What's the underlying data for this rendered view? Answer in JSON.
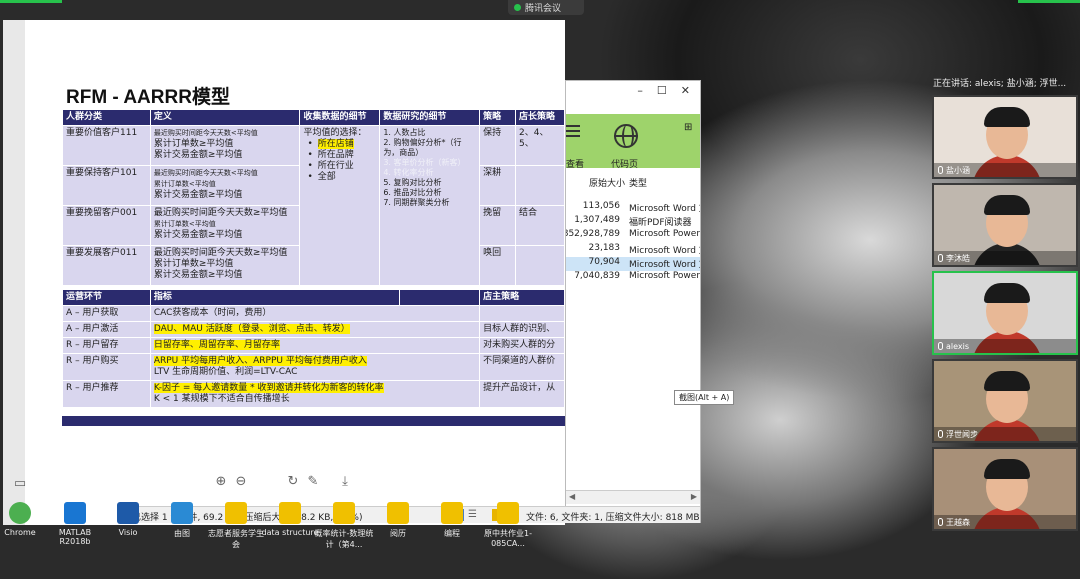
{
  "meeting": {
    "tab_label": "腾讯会议"
  },
  "slide": {
    "title": "RFM - AARRR模型",
    "rfm_headers": [
      "人群分类",
      "定义",
      "收集数据的细节",
      "数据研究的细节",
      "策略",
      "店长策略"
    ],
    "rfm_rows": [
      {
        "segment": "重要价值客户111",
        "def": [
          [
            "最近购买时间距今天天数<平均值",
            "small"
          ],
          [
            "累计订单数≥平均值",
            ""
          ],
          [
            "累计交易金额≥平均值",
            ""
          ]
        ],
        "strategy": "保持",
        "store": "2、4、5、"
      },
      {
        "segment": "重要保持客户101",
        "def": [
          [
            "最近购买时间距今天天数<平均值",
            "small"
          ],
          [
            "累计订单数<平均值",
            "small"
          ],
          [
            "累计交易金额≥平均值",
            ""
          ]
        ],
        "strategy": "深耕",
        "store": ""
      },
      {
        "segment": "重要挽留客户001",
        "def": [
          [
            "最近购买时间距今天天数≥平均值",
            ""
          ],
          [
            "累计订单数<平均值",
            "small"
          ],
          [
            "累计交易金额≥平均值",
            ""
          ]
        ],
        "strategy": "挽留",
        "store": "结合"
      },
      {
        "segment": "重要发展客户011",
        "def": [
          [
            "最近购买时间距今天天数≥平均值",
            ""
          ],
          [
            "累计订单数≥平均值",
            ""
          ],
          [
            "累计交易金额≥平均值",
            ""
          ]
        ],
        "strategy": "唤回",
        "store": ""
      }
    ],
    "collect_intro": "平均值的选择：",
    "collect_items": [
      "所在店铺",
      "所在品牌",
      "所在行业",
      "全部"
    ],
    "research_items": [
      {
        "text": "1.   人数占比",
        "faded": false
      },
      {
        "text": "2.   购物偏好分析*（行为，商品）",
        "faded": false
      },
      {
        "text": "3.   客单价分析（新客）",
        "faded": true
      },
      {
        "text": "4.   转化率分析",
        "faded": true
      },
      {
        "text": "5.   复购对比分析",
        "faded": false
      },
      {
        "text": "6.   推品对比分析",
        "faded": false
      },
      {
        "text": "7.   同期群聚类分析",
        "faded": false
      }
    ],
    "ops_headers": [
      "运营环节",
      "指标",
      "",
      "店主策略"
    ],
    "ops_rows": [
      {
        "stage": "A – 用户获取",
        "metric": "CAC获客成本（时间，费用）",
        "metric2": "",
        "hl": false,
        "strategy": ""
      },
      {
        "stage": "A – 用户激活",
        "metric": "DAU、MAU 活跃度（登录、浏览、点击、转发）",
        "metric2": "",
        "hl": true,
        "strategy": "目标人群的识别、"
      },
      {
        "stage": "R – 用户留存",
        "metric": "日留存率、周留存率、月留存率",
        "metric2": "",
        "hl": true,
        "strategy": "对未购买人群的分"
      },
      {
        "stage": "R – 用户购买",
        "metric": "ARPU 平均每用户收入、ARPPU 平均每付费用户收入",
        "metric2": "LTV 生命周期价值、利润=LTV-CAC",
        "hl": true,
        "strategy": "不同渠道的人群价"
      },
      {
        "stage": "R – 用户推荐",
        "metric": "K-因子 = 每人邀请数量 * 收到邀请并转化为新客的转化率",
        "metric2": "K < 1 某规模下不适合自传播增长",
        "hl": true,
        "strategy": "提升产品设计，从"
      }
    ]
  },
  "file_manager": {
    "ribbon_left": "查看",
    "ribbon_center": "代码页",
    "col_size": "原始大小",
    "col_type": "类型",
    "rows": [
      {
        "size": "113,056",
        "type": "Microsoft Word 文",
        "selected": false
      },
      {
        "size": "1,307,489",
        "type": "福昕PDF阅读器",
        "selected": false
      },
      {
        "size": "852,928,789",
        "type": "Microsoft Power",
        "selected": false
      },
      {
        "size": "23,183",
        "type": "Microsoft Word 文",
        "selected": false
      },
      {
        "size": "70,904",
        "type": "Microsoft Word 文",
        "selected": true
      },
      {
        "size": "7,040,839",
        "type": "Microsoft Power",
        "selected": false
      }
    ],
    "status_left": "已选择 1 个文件, 69.2 KB (压缩后大小: 68.2 KB, 1.5%)",
    "status_right": "文件: 6, 文件夹: 1, 压缩文件大小: 818 MB",
    "tooltip": "截图(Alt + A)"
  },
  "desktop_icons": [
    {
      "label": "Chrome"
    },
    {
      "label": "MATLAB R2018b"
    },
    {
      "label": "Visio"
    },
    {
      "label": "由图"
    },
    {
      "label": "志愿者服务学生会"
    },
    {
      "label": "data structure"
    },
    {
      "label": "概率统计-数理统计（第4..."
    },
    {
      "label": "阅历"
    },
    {
      "label": "编程"
    },
    {
      "label": "原中共作业1-085CA..."
    }
  ],
  "participants": {
    "speaking_label": "正在讲话: alexis; 盐小涵; 浮世...",
    "tiles": [
      {
        "name": "盐小涵",
        "active": false,
        "bg": "#e8e0d8",
        "shirt": "#c0392b"
      },
      {
        "name": "李沐皓",
        "active": false,
        "bg": "#bfb7ae",
        "shirt": "#222"
      },
      {
        "name": "alexis",
        "active": true,
        "bg": "#d8d8d8",
        "shirt": "#c0392b"
      },
      {
        "name": "浮世闻步",
        "active": false,
        "bg": "#a89478",
        "shirt": "#c0392b"
      },
      {
        "name": "王越森",
        "active": false,
        "bg": "#a89078",
        "shirt": "#c0392b"
      }
    ]
  }
}
